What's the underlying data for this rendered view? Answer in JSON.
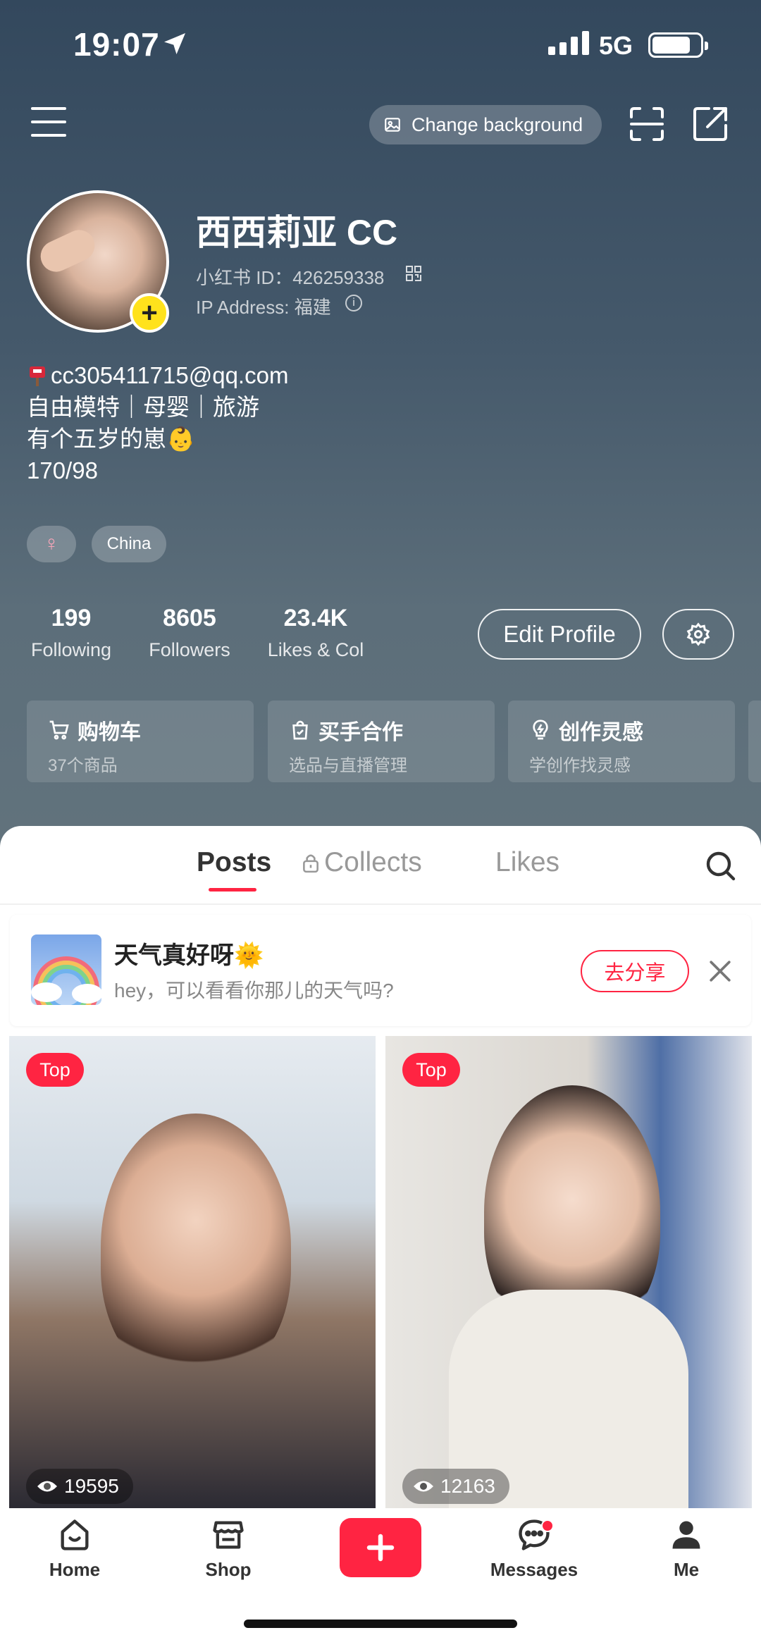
{
  "status_bar": {
    "time": "19:07",
    "network": "5G"
  },
  "top_nav": {
    "change_background": "Change background"
  },
  "profile": {
    "name": "西西莉亚 CC",
    "user_id": "小红书 ID：426259338",
    "ip_address": "IP Address: 福建",
    "bio": [
      "cc305411715@qq.com",
      "自由模特｜母婴｜旅游",
      "有个五岁的崽👶",
      "170/98"
    ],
    "tags": {
      "gender": "♀",
      "country": "China"
    }
  },
  "stats": [
    {
      "value": "199",
      "label": "Following"
    },
    {
      "value": "8605",
      "label": "Followers"
    },
    {
      "value": "23.4K",
      "label": "Likes & Col"
    }
  ],
  "buttons": {
    "edit_profile": "Edit Profile"
  },
  "features": [
    {
      "title": "购物车",
      "subtitle": "37个商品"
    },
    {
      "title": "买手合作",
      "subtitle": "选品与直播管理"
    },
    {
      "title": "创作灵感",
      "subtitle": "学创作找灵感"
    }
  ],
  "tabs": [
    "Posts",
    "Collects",
    "Likes"
  ],
  "weather_card": {
    "title": "天气真好呀🌞",
    "subtitle": "hey，可以看看你那儿的天气吗?",
    "action": "去分享"
  },
  "posts": [
    {
      "badge": "Top",
      "views": "19595"
    },
    {
      "badge": "Top",
      "views": "12163"
    }
  ],
  "bottom_nav": [
    "Home",
    "Shop",
    "Messages",
    "Me"
  ],
  "colors": {
    "accent": "#ff2442",
    "avatar_badge": "#ffe21c"
  }
}
